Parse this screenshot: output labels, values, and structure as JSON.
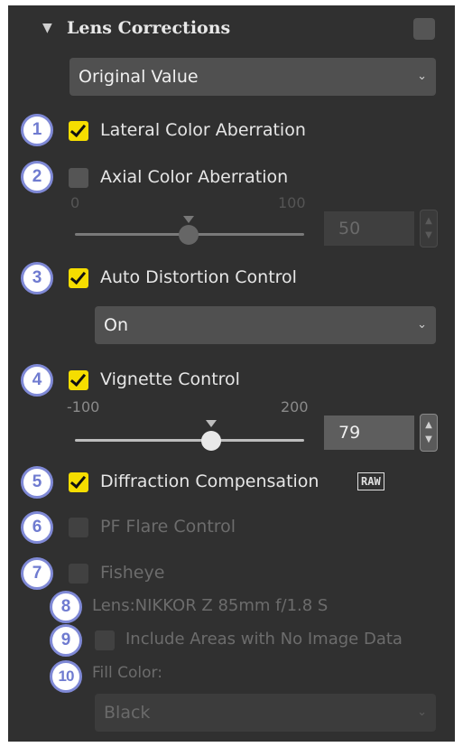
{
  "header": {
    "title": "Lens Corrections"
  },
  "preset_select": {
    "value": "Original Value"
  },
  "lateral": {
    "badge": "1",
    "label": "Lateral Color Aberration",
    "checked": true
  },
  "axial": {
    "badge": "2",
    "label": "Axial Color Aberration",
    "checked": false,
    "slider": {
      "min_label": "0",
      "max_label": "100",
      "value": "50"
    }
  },
  "distortion": {
    "badge": "3",
    "label": "Auto Distortion Control",
    "checked": true,
    "select_value": "On"
  },
  "vignette": {
    "badge": "4",
    "label": "Vignette Control",
    "checked": true,
    "slider": {
      "min_label": "-100",
      "max_label": "200",
      "value": "79"
    }
  },
  "diffraction": {
    "badge": "5",
    "label": "Diffraction Compensation",
    "checked": true,
    "raw_badge": "RAW"
  },
  "pf_flare": {
    "badge": "6",
    "label": "PF Flare Control",
    "checked": false
  },
  "fisheye": {
    "badge": "7",
    "label": "Fisheye",
    "checked": false,
    "lens_badge": "8",
    "lens_label": "Lens:NIKKOR Z 85mm f/1.8 S",
    "include_badge": "9",
    "include_label": "Include Areas with No Image Data",
    "fill_badge": "10",
    "fill_label": "Fill Color:",
    "fill_value": "Black"
  },
  "colors": {
    "panel": "#303030",
    "check_on": "#f5dd00",
    "badge_border": "#7f89d6",
    "badge_text": "#6f7bd0"
  }
}
